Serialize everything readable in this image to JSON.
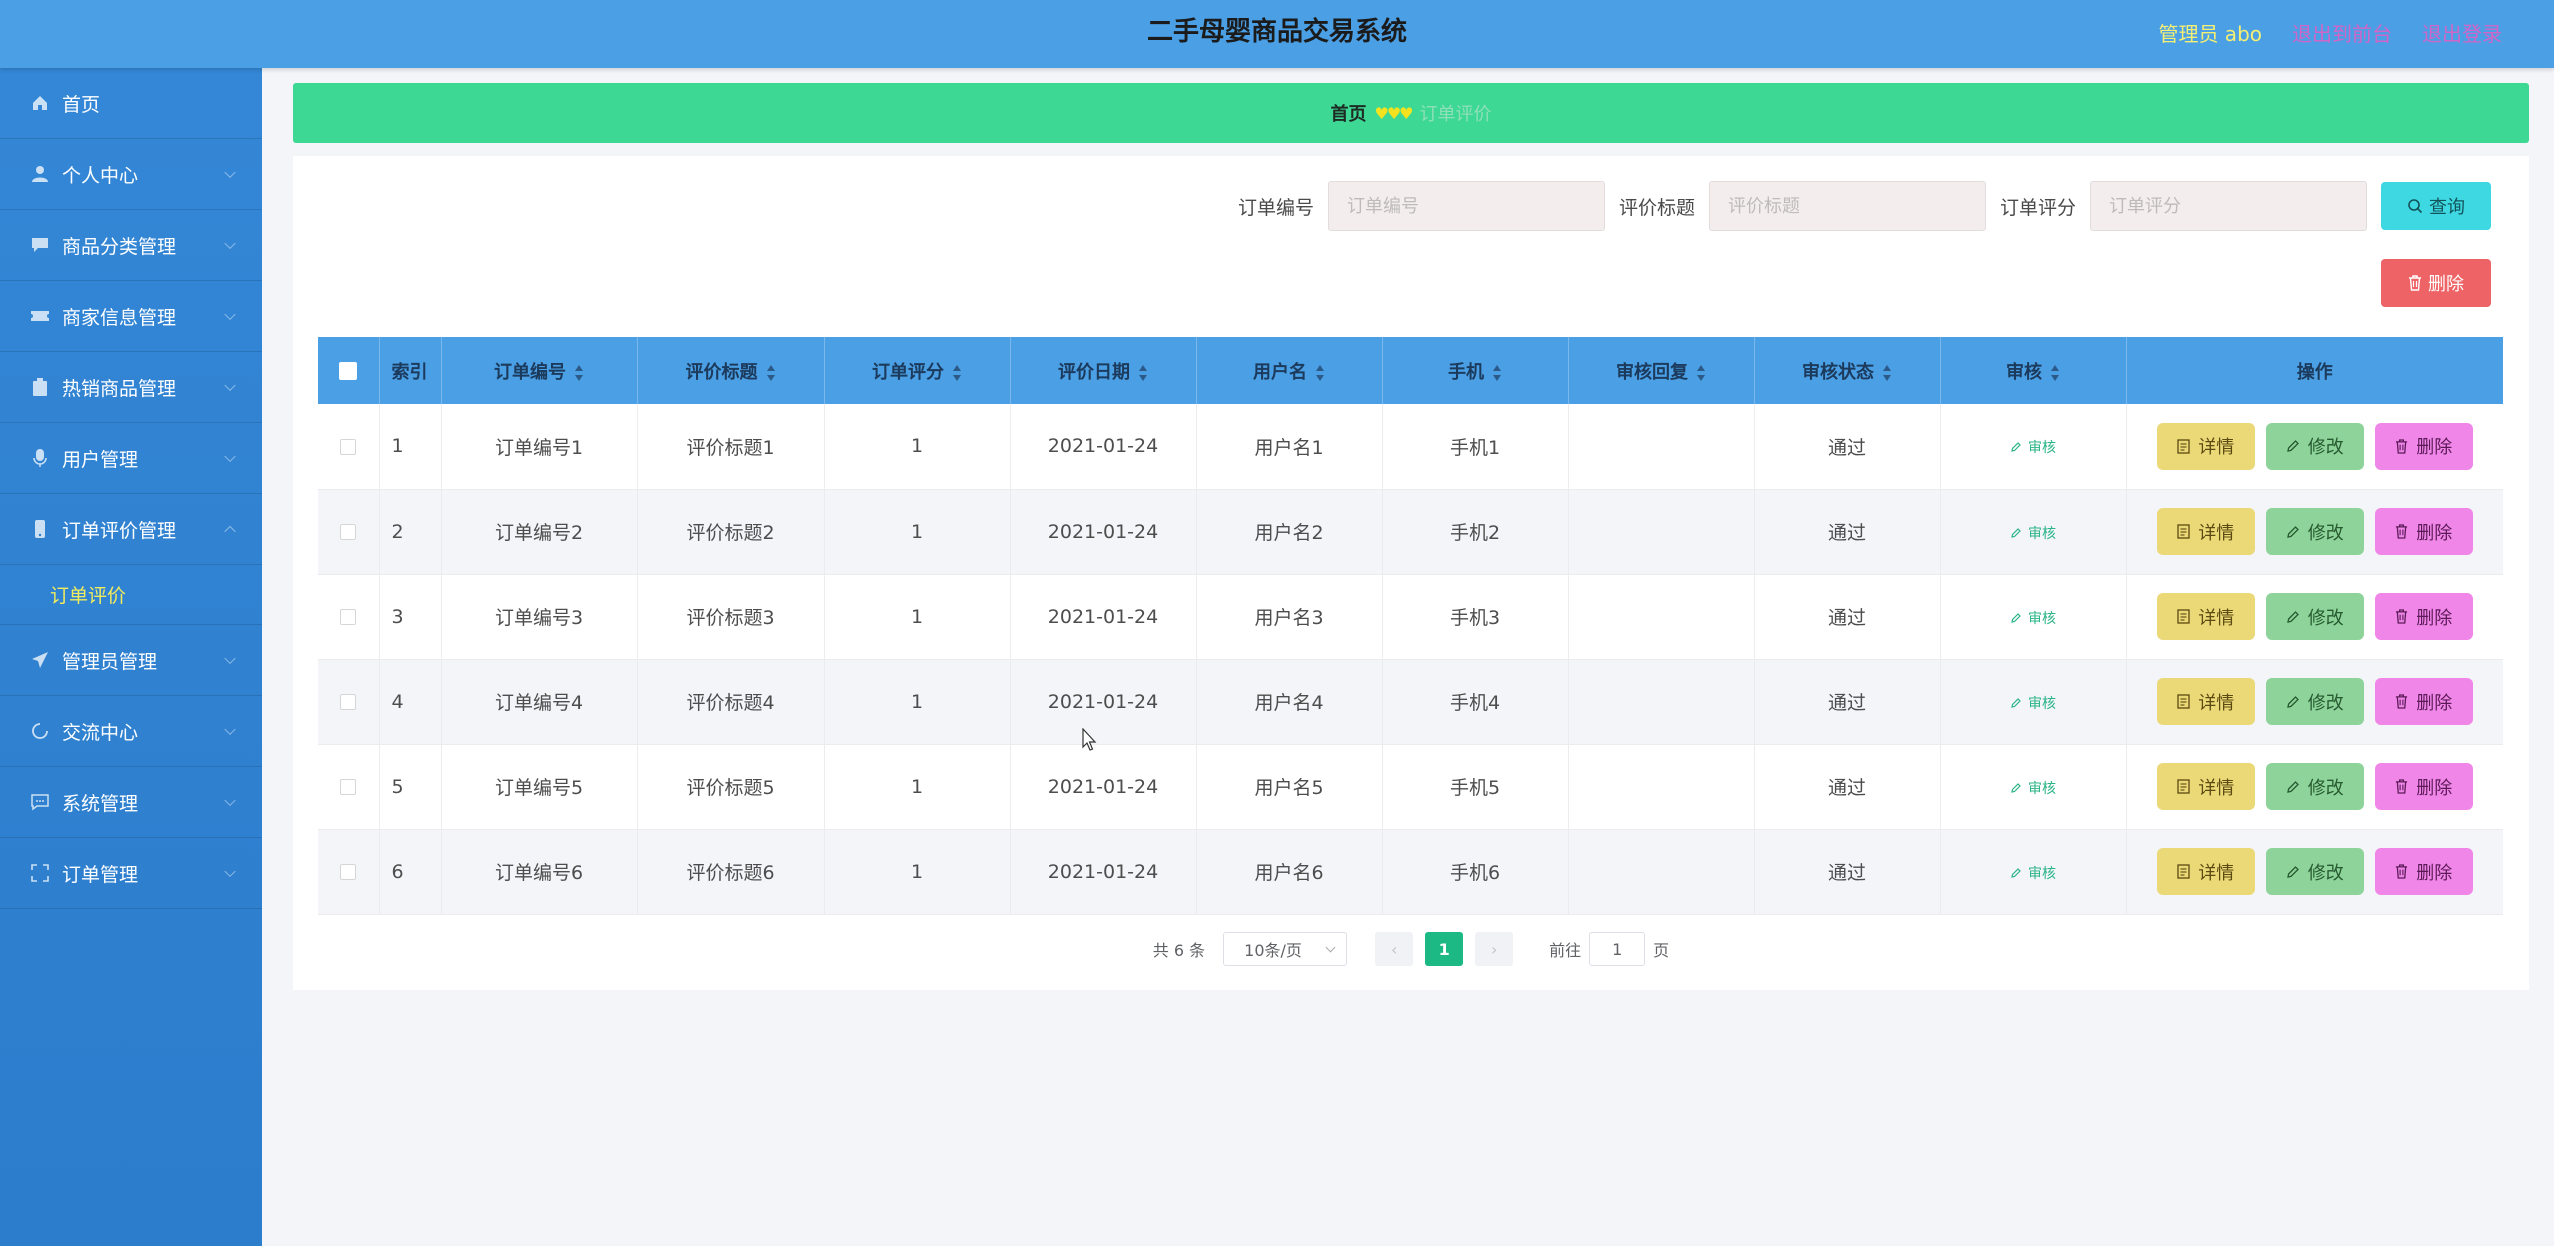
{
  "header": {
    "title": "二手母婴商品交易系统",
    "admin": "管理员 abo",
    "to_front": "退出到前台",
    "logout": "退出登录"
  },
  "sidebar": {
    "items": [
      {
        "label": "首页",
        "icon": "home-icon"
      },
      {
        "label": "个人中心",
        "icon": "user-icon"
      },
      {
        "label": "商品分类管理",
        "icon": "chat-icon"
      },
      {
        "label": "商家信息管理",
        "icon": "ticket-icon"
      },
      {
        "label": "热销商品管理",
        "icon": "clipboard-icon"
      },
      {
        "label": "用户管理",
        "icon": "mic-icon"
      },
      {
        "label": "订单评价管理",
        "icon": "phone-icon"
      },
      {
        "label": "管理员管理",
        "icon": "send-icon"
      },
      {
        "label": "交流中心",
        "icon": "loading-icon"
      },
      {
        "label": "系统管理",
        "icon": "message-icon"
      },
      {
        "label": "订单管理",
        "icon": "fullscreen-icon"
      }
    ],
    "submenu_label": "订单评价"
  },
  "breadcrumb": {
    "home": "首页",
    "separator": "♥♥♥",
    "current": "订单评价"
  },
  "search": {
    "order_no_label": "订单编号",
    "order_no_placeholder": "订单编号",
    "title_label": "评价标题",
    "title_placeholder": "评价标题",
    "score_label": "订单评分",
    "score_placeholder": "订单评分",
    "query_button": "查询",
    "delete_button": "删除"
  },
  "table": {
    "headers": [
      "索引",
      "订单编号",
      "评价标题",
      "订单评分",
      "评价日期",
      "用户名",
      "手机",
      "审核回复",
      "审核状态",
      "审核",
      "操作"
    ],
    "rows": [
      {
        "index": "1",
        "order_no": "订单编号1",
        "title": "评价标题1",
        "score": "1",
        "date": "2021-01-24",
        "user": "用户名1",
        "phone": "手机1",
        "reply": "",
        "status": "通过"
      },
      {
        "index": "2",
        "order_no": "订单编号2",
        "title": "评价标题2",
        "score": "1",
        "date": "2021-01-24",
        "user": "用户名2",
        "phone": "手机2",
        "reply": "",
        "status": "通过"
      },
      {
        "index": "3",
        "order_no": "订单编号3",
        "title": "评价标题3",
        "score": "1",
        "date": "2021-01-24",
        "user": "用户名3",
        "phone": "手机3",
        "reply": "",
        "status": "通过"
      },
      {
        "index": "4",
        "order_no": "订单编号4",
        "title": "评价标题4",
        "score": "1",
        "date": "2021-01-24",
        "user": "用户名4",
        "phone": "手机4",
        "reply": "",
        "status": "通过"
      },
      {
        "index": "5",
        "order_no": "订单编号5",
        "title": "评价标题5",
        "score": "1",
        "date": "2021-01-24",
        "user": "用户名5",
        "phone": "手机5",
        "reply": "",
        "status": "通过"
      },
      {
        "index": "6",
        "order_no": "订单编号6",
        "title": "评价标题6",
        "score": "1",
        "date": "2021-01-24",
        "user": "用户名6",
        "phone": "手机6",
        "reply": "",
        "status": "通过"
      }
    ],
    "audit_link": "审核",
    "detail_button": "详情",
    "edit_button": "修改",
    "delete_button": "删除"
  },
  "pagination": {
    "total": "共 6 条",
    "page_size": "10条/页",
    "current_page": "1",
    "goto_label": "前往",
    "goto_value": "1",
    "page_suffix": "页"
  },
  "colors": {
    "header_bg": "#4a9fe5",
    "sidebar_bg": "#2c7dcc",
    "breadcrumb_bg": "#3dd893",
    "query_button": "#3ed8e2",
    "delete_button": "#ee6466",
    "detail_button": "#ebd876",
    "edit_button": "#8ed49a",
    "remove_button": "#ef86e8",
    "active_page": "#1cb985"
  }
}
